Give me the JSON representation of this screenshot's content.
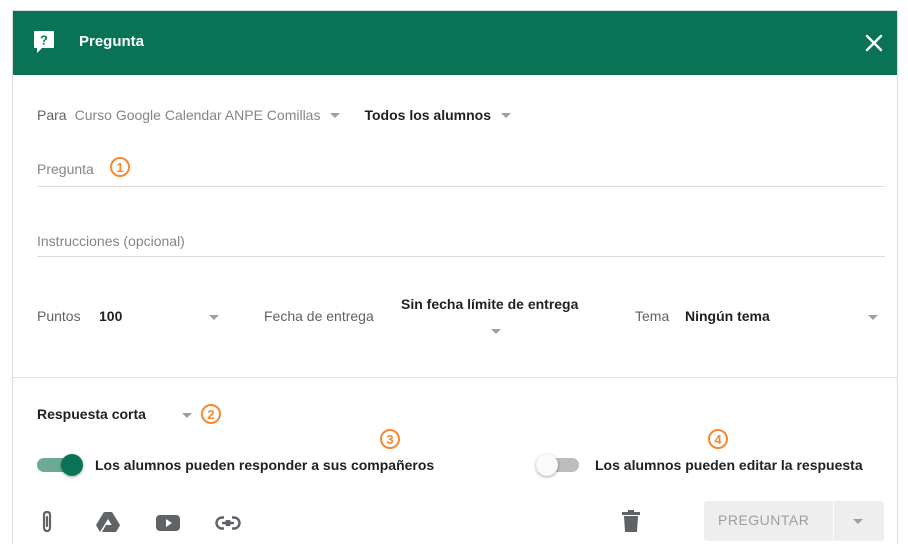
{
  "header": {
    "title": "Pregunta",
    "icon": "question-mark-icon",
    "close_icon": "close-icon",
    "color": "#0a7356"
  },
  "audience": {
    "prefix": "Para",
    "course": "Curso Google Calendar ANPE Comillas",
    "students": "Todos los alumnos"
  },
  "question": {
    "placeholder": "Pregunta",
    "marker": "1"
  },
  "instructions": {
    "placeholder": "Instrucciones (opcional)"
  },
  "points": {
    "label": "Puntos",
    "value": "100"
  },
  "due": {
    "label": "Fecha de entrega",
    "value": "Sin fecha límite de entrega"
  },
  "topic": {
    "label": "Tema",
    "value": "Ningún tema"
  },
  "answer_type": {
    "value": "Respuesta corta",
    "marker": "2"
  },
  "toggles": [
    {
      "label": "Los alumnos pueden responder a sus compañeros",
      "on": true,
      "marker": "3"
    },
    {
      "label": "Los alumnos pueden editar la respuesta",
      "on": false,
      "marker": "4"
    }
  ],
  "attachments": [
    "paperclip-icon",
    "drive-icon",
    "youtube-icon",
    "link-icon"
  ],
  "actions": {
    "delete_icon": "trash-icon",
    "submit_label": "PREGUNTAR"
  },
  "accent_marker_color": "#f7882f"
}
